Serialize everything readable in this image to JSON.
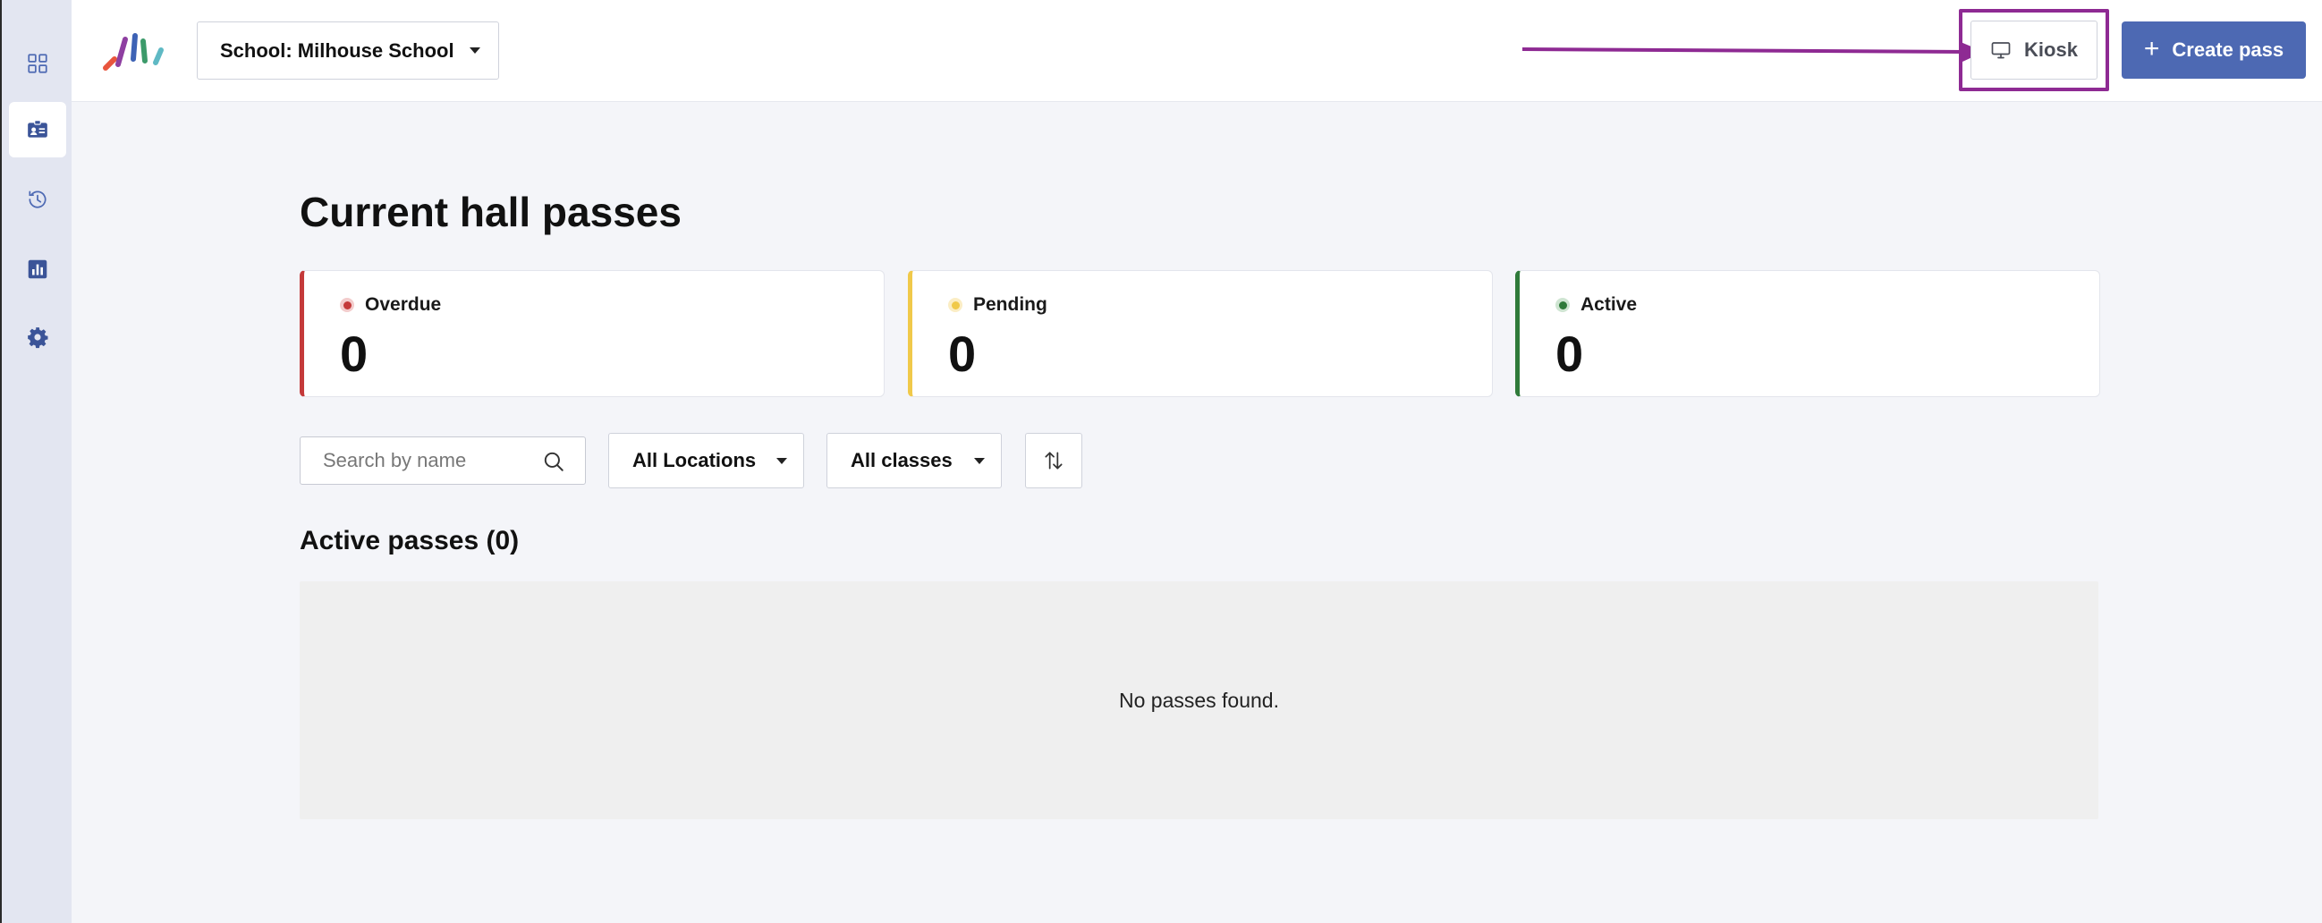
{
  "sidebar": {
    "items": [
      {
        "icon": "dashboard-grid-icon",
        "active": false
      },
      {
        "icon": "id-card-icon",
        "active": true
      },
      {
        "icon": "history-icon",
        "active": false
      },
      {
        "icon": "bar-chart-icon",
        "active": false
      },
      {
        "icon": "gear-icon",
        "active": false
      }
    ]
  },
  "header": {
    "school_select": "School: Milhouse School",
    "kiosk_label": "Kiosk",
    "create_pass_label": "Create pass",
    "plus": "+"
  },
  "colors": {
    "brand_blue": "#4d69b3",
    "highlight_purple": "#8e2a93",
    "overdue": "#c43a3a",
    "pending": "#f0c94a",
    "active": "#2f7a3a"
  },
  "main": {
    "title": "Current hall passes",
    "stats": [
      {
        "label": "Overdue",
        "value": "0"
      },
      {
        "label": "Pending",
        "value": "0"
      },
      {
        "label": "Active",
        "value": "0"
      }
    ],
    "filters": {
      "search_placeholder": "Search by name",
      "locations": "All Locations",
      "classes": "All classes"
    },
    "section_title": "Active passes (0)",
    "empty_message": "No passes found."
  }
}
